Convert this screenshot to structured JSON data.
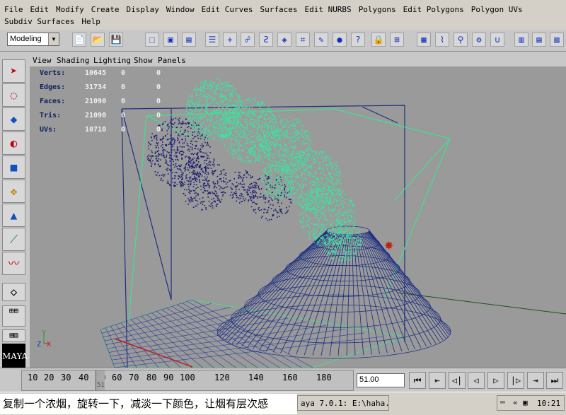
{
  "menubar": {
    "row1": [
      "File",
      "Edit",
      "Modify",
      "Create",
      "Display",
      "Window",
      "Edit Curves",
      "Surfaces",
      "Edit NURBS",
      "Polygons",
      "Edit Polygons",
      "Polygon UVs"
    ],
    "row2": [
      "Subdiv Surfaces",
      "Help"
    ]
  },
  "shelf": {
    "mode": "Modeling"
  },
  "panel_menu": [
    "View",
    "Shading",
    "Lighting",
    "Show",
    "Panels"
  ],
  "hud": [
    {
      "label": "Verts:",
      "v1": "10645",
      "v2": "0",
      "v3": "0"
    },
    {
      "label": "Edges:",
      "v1": "31734",
      "v2": "0",
      "v3": "0"
    },
    {
      "label": "Faces:",
      "v1": "21090",
      "v2": "0",
      "v3": "0"
    },
    {
      "label": "Tris:",
      "v1": "21090",
      "v2": "0",
      "v3": "0"
    },
    {
      "label": "UVs:",
      "v1": "10710",
      "v2": "0",
      "v3": "0"
    }
  ],
  "axis": {
    "y": "Y",
    "x": "X",
    "z": "Z"
  },
  "timeline": {
    "ticks": [
      "10",
      "20",
      "30",
      "40",
      "50",
      "60",
      "70",
      "80",
      "90",
      "100",
      "120",
      "140",
      "160",
      "180"
    ],
    "current_marker": "51",
    "current_frame": "51.00"
  },
  "taskbar": {
    "caption": "复制一个浓烟，旋转一下，减淡一下颜色，让烟有层次感",
    "task_label": "aya 7.0.1: E:\\haha...",
    "clock": "10:21"
  },
  "logo_text": "MAYA",
  "colors": {
    "smoke_green": "#40e0a0",
    "smoke_blue": "#1a1a70",
    "wire_blue": "#1a2a80",
    "cage_green": "#40e090",
    "viewport_bg": "#9a9a9a"
  }
}
